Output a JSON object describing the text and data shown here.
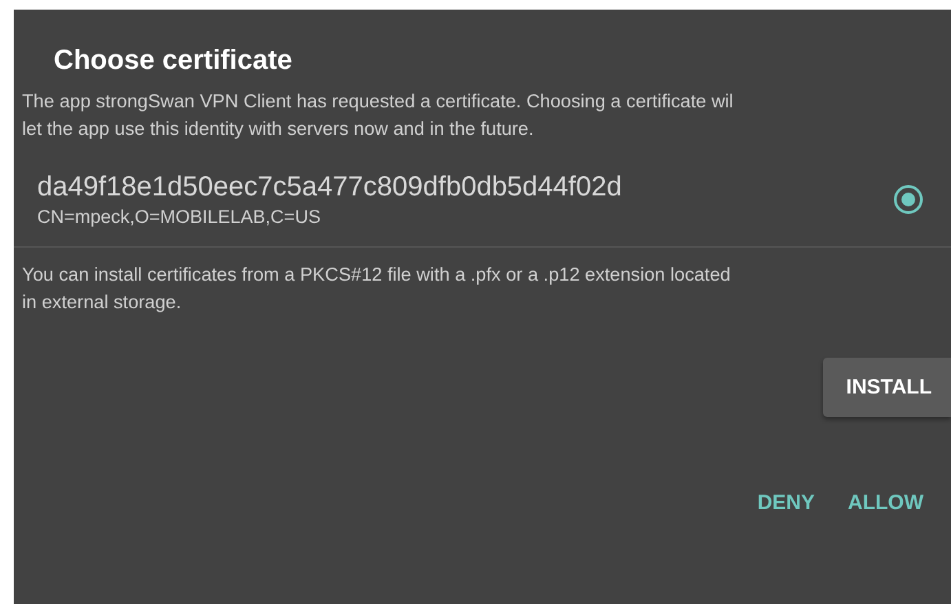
{
  "dialog": {
    "title": "Choose certificate",
    "message_lines": [
      "The app strongSwan VPN Client has requested a certificate. Choosing a certificate wil",
      "let the app use this identity with servers now and in the future."
    ],
    "certificates": [
      {
        "alias": "da49f18e1d50eec7c5a477c809dfb0db5d44f02d",
        "subject": "CN=mpeck,O=MOBILELAB,C=US",
        "selected": true
      }
    ],
    "install_hint_lines": [
      "You can install certificates from a PKCS#12 file with a .pfx or a .p12 extension located",
      "in external storage."
    ],
    "install_button": "INSTALL",
    "actions": [
      "DENY",
      "ALLOW"
    ]
  }
}
